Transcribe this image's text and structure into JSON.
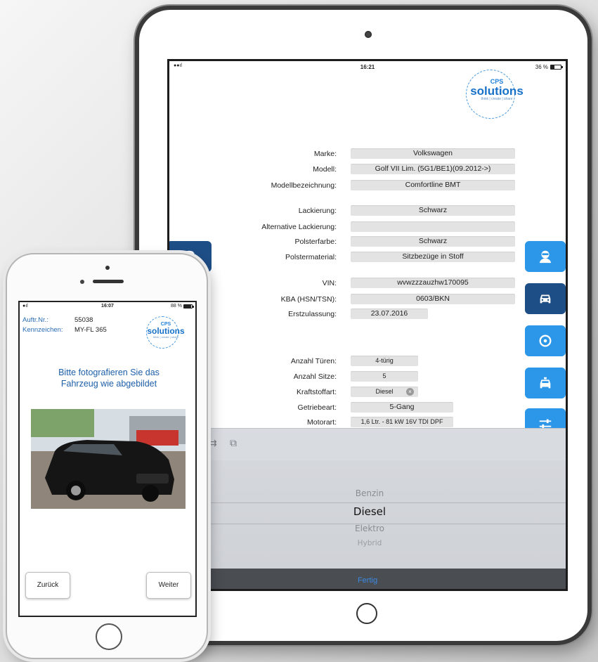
{
  "ipad": {
    "status": {
      "time": "16:21",
      "battery": "36 %",
      "battery_level": 0.36
    },
    "logo": {
      "line1": "CPS",
      "line2": "solutions",
      "tagline": "think | create | share"
    },
    "fields": [
      {
        "label": "Marke:",
        "value": "Volkswagen"
      },
      {
        "label": "Modell:",
        "value": "Golf VII Lim. (5G1/BE1)(09.2012->)"
      },
      {
        "label": "Modellbezeichnung:",
        "value": "Comfortline BMT"
      },
      {
        "label": "Lackierung:",
        "value": "Schwarz"
      },
      {
        "label": "Alternative Lackierung:",
        "value": ""
      },
      {
        "label": "Polsterfarbe:",
        "value": "Schwarz"
      },
      {
        "label": "Polstermaterial:",
        "value": "Sitzbezüge in Stoff"
      },
      {
        "label": "VIN:",
        "value": "wvwzzzauzhw170095"
      },
      {
        "label": "KBA (HSN/TSN):",
        "value": "0603/BKN"
      },
      {
        "label": "Erstzulassung:",
        "value": "23.07.2016"
      },
      {
        "label": "Anzahl Türen:",
        "value": "4-türig"
      },
      {
        "label": "Anzahl Sitze:",
        "value": "5"
      },
      {
        "label": "Kraftstoffart:",
        "value": "Diesel"
      },
      {
        "label": "Getriebeart:",
        "value": "5-Gang"
      },
      {
        "label": "Motorart:",
        "value": "1,6 Ltr. - 81 kW 16V TDI DPF"
      }
    ],
    "side_buttons": [
      "person-icon",
      "car-icon",
      "steering-wheel-icon",
      "taxi-icon",
      "sliders-icon"
    ],
    "picker": {
      "options": [
        "Benzin",
        "Diesel",
        "Elektro",
        "Hybrid"
      ],
      "selected": "Diesel",
      "done_label": "Fertig"
    }
  },
  "iphone": {
    "status": {
      "time": "16:07",
      "battery": "88 %",
      "battery_level": 0.88
    },
    "order_label": "Auftr.Nr.:",
    "order_value": "55038",
    "plate_label": "Kennzeichen:",
    "plate_value": "MY-FL 365",
    "logo": {
      "line1": "CPS",
      "line2": "solutions",
      "tagline": "think | create | share"
    },
    "instruction_line1": "Bitte fotografieren Sie das",
    "instruction_line2": "Fahrzeug wie abgebildet",
    "back_label": "Zurück",
    "next_label": "Weiter"
  },
  "colors": {
    "accent_light": "#2c96e8",
    "accent_dark": "#1e4e86",
    "logo_blue": "#1c7fd6"
  }
}
